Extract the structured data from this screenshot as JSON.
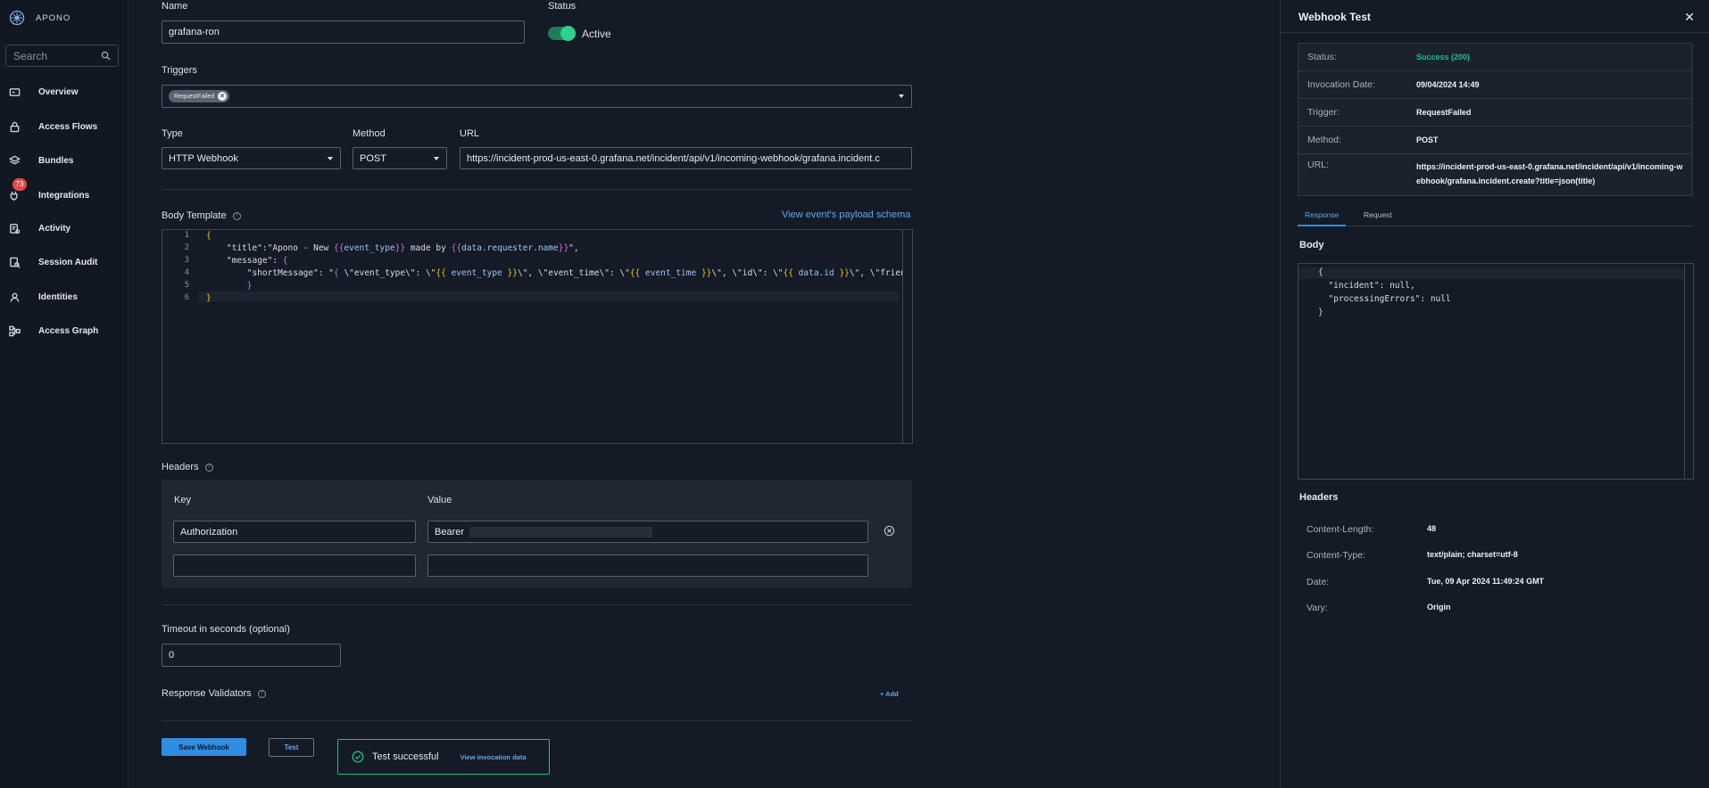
{
  "sidebar": {
    "brand": "APONO",
    "search_placeholder": "Search",
    "items": [
      {
        "label": "Overview",
        "icon": "dashboard-icon"
      },
      {
        "label": "Access Flows",
        "icon": "lock-icon"
      },
      {
        "label": "Bundles",
        "icon": "layers-icon"
      },
      {
        "label": "Integrations",
        "icon": "plug-icon",
        "badge": "73"
      },
      {
        "label": "Activity",
        "icon": "activity-icon"
      },
      {
        "label": "Session Audit",
        "icon": "session-audit-icon"
      },
      {
        "label": "Identities",
        "icon": "identities-icon"
      },
      {
        "label": "Access Graph",
        "icon": "graph-icon"
      }
    ]
  },
  "form": {
    "name_label": "Name",
    "name_value": "grafana-ron",
    "status_label": "Status",
    "status_value": "Active",
    "triggers_label": "Triggers",
    "trigger_chip": "RequestFailed",
    "type_label": "Type",
    "type_value": "HTTP Webhook",
    "method_label": "Method",
    "method_value": "POST",
    "url_label": "URL",
    "url_value": "https://incident-prod-us-east-0.grafana.net/incident/api/v1/incoming-webhook/grafana.incident.c",
    "body_template_label": "Body Template",
    "payload_link": "View event's payload schema",
    "headers_label": "Headers",
    "key_label": "Key",
    "value_label": "Value",
    "header_key": "Authorization",
    "header_value": "Bearer",
    "timeout_label": "Timeout in seconds (optional)",
    "timeout_value": "0",
    "validators_label": "Response Validators",
    "add_label": "+ Add",
    "save_label": "Save Webhook",
    "test_label": "Test",
    "toast_text": "Test successful",
    "toast_link": "View invocation data"
  },
  "editor": {
    "line_numbers": [
      "1",
      "2",
      "3",
      "4",
      "5",
      "6"
    ]
  },
  "panel": {
    "title": "Webhook Test",
    "close": "✕",
    "status_key": "Status:",
    "status_value": "Success (200)",
    "date_key": "Invocation Date:",
    "date_value": "09/04/2024 14:49",
    "trigger_key": "Trigger:",
    "trigger_value": "RequestFailed",
    "method_key": "Method:",
    "method_value": "POST",
    "url_key": "URL:",
    "url_value": "https://incident-prod-us-east-0.grafana.net/incident/api/v1/incoming-webhook/grafana.incident.create?title=json(title)",
    "tab_response": "Response",
    "tab_request": "Request",
    "body_label": "Body",
    "body_lines": [
      "{",
      "  \"incident\": null,",
      "  \"processingErrors\": null",
      "}"
    ],
    "headers_label": "Headers",
    "headers": [
      {
        "key": "Content-Length:",
        "value": "48"
      },
      {
        "key": "Content-Type:",
        "value": "text/plain; charset=utf-8"
      },
      {
        "key": "Date:",
        "value": "Tue, 09 Apr 2024 11:49:24 GMT"
      },
      {
        "key": "Vary:",
        "value": "Origin"
      }
    ]
  },
  "colors": {
    "accent": "#2f8de4",
    "success": "#1fbf83",
    "badge": "#e5484d"
  }
}
